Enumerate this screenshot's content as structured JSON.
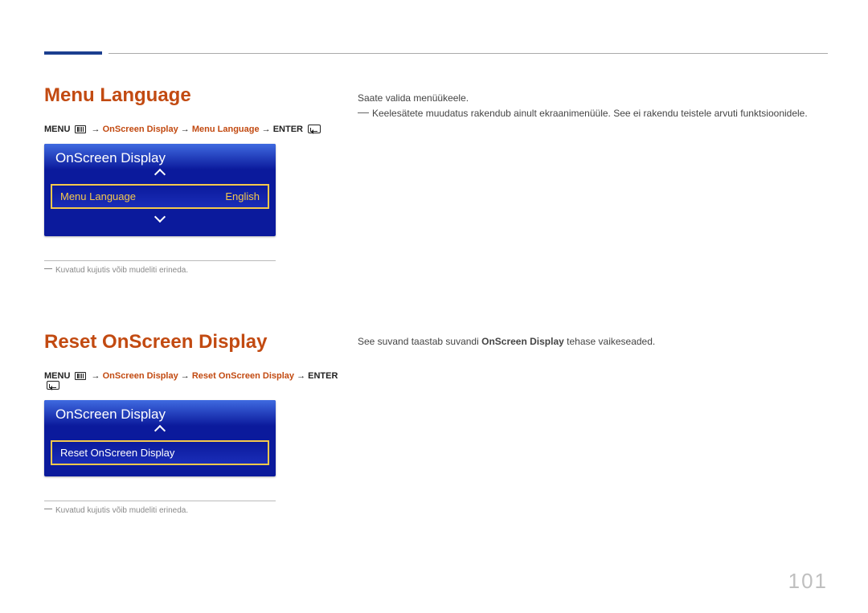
{
  "page_number": "101",
  "section1": {
    "heading": "Menu Language",
    "path": {
      "p1": "MENU",
      "p2": "OnScreen Display",
      "p3": "Menu Language",
      "p4": "ENTER"
    },
    "osd": {
      "title": "OnScreen Display",
      "item_label": "Menu Language",
      "item_value": "English"
    },
    "footnote": "Kuvatud kujutis võib mudeliti erineda.",
    "body_line1": "Saate valida menüükeele.",
    "body_line2": "Keelesätete muudatus rakendub ainult ekraanimenüüle. See ei rakendu teistele arvuti funktsioonidele."
  },
  "section2": {
    "heading": "Reset OnScreen Display",
    "path": {
      "p1": "MENU",
      "p2": "OnScreen Display",
      "p3": "Reset OnScreen Display",
      "p4": "ENTER"
    },
    "osd": {
      "title": "OnScreen Display",
      "item_label": "Reset OnScreen Display"
    },
    "footnote": "Kuvatud kujutis võib mudeliti erineda.",
    "body_pre": "See suvand taastab suvandi ",
    "body_bold": "OnScreen Display",
    "body_post": " tehase vaikeseaded."
  }
}
